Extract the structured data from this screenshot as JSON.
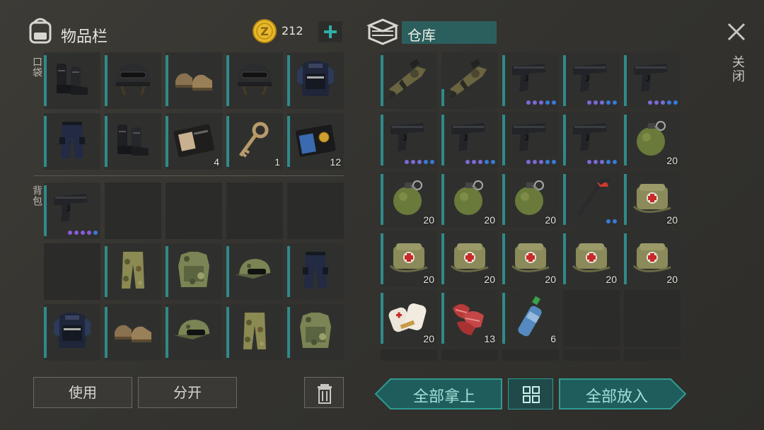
{
  "inventory": {
    "title": "物品栏",
    "coins": "212",
    "pocket_label": "口袋",
    "backpack_label": "背包",
    "pocket": [
      {
        "icon": "boots-icon"
      },
      {
        "icon": "helmet-icon"
      },
      {
        "icon": "shoes-icon"
      },
      {
        "icon": "helmet-icon"
      },
      {
        "icon": "police-vest-icon"
      },
      {
        "icon": "police-pants-icon"
      },
      {
        "icon": "boots-icon"
      },
      {
        "icon": "wallet-icon",
        "count": "4"
      },
      {
        "icon": "key-icon",
        "count": "1"
      },
      {
        "icon": "badge-wallet-icon",
        "count": "12"
      }
    ],
    "backpack": [
      {
        "icon": "pistol-icon",
        "dots": [
          "#8a5ad8",
          "#8a5ad8",
          "#8a5ad8",
          "#8a5ad8",
          "#3a7ad8"
        ]
      },
      {},
      {},
      {},
      {},
      {},
      {
        "icon": "camo-pants-icon"
      },
      {
        "icon": "camo-vest-icon"
      },
      {
        "icon": "camo-cap-icon"
      },
      {
        "icon": "police-pants-icon"
      },
      {
        "icon": "police-vest-icon"
      },
      {
        "icon": "shoes-icon"
      },
      {
        "icon": "camo-cap-icon"
      },
      {
        "icon": "camo-pants-icon"
      },
      {
        "icon": "camo-vest-icon"
      }
    ],
    "use_label": "使用",
    "split_label": "分开"
  },
  "storage": {
    "title": "仓库",
    "close_label": "关闭",
    "take_all_label": "全部拿上",
    "put_all_label": "全部放入",
    "items": [
      {
        "icon": "grenade-launcher-icon"
      },
      {
        "icon": "grenade-launcher-icon",
        "short": true
      },
      {
        "icon": "pistol-icon",
        "dots": [
          "#7a6ad8",
          "#7a6ad8",
          "#7a6ad8",
          "#3a7ad8",
          "#3a7ad8"
        ]
      },
      {
        "icon": "pistol-icon",
        "dots": [
          "#7a6ad8",
          "#7a6ad8",
          "#7a6ad8",
          "#3a7ad8",
          "#3a7ad8"
        ]
      },
      {
        "icon": "pistol-icon",
        "dots": [
          "#7a6ad8",
          "#7a6ad8",
          "#7a6ad8",
          "#3a7ad8",
          "#3a7ad8"
        ]
      },
      {
        "icon": "pistol-icon",
        "dots": [
          "#7a6ad8",
          "#7a6ad8",
          "#7a6ad8",
          "#3a7ad8",
          "#3a7ad8"
        ]
      },
      {
        "icon": "pistol-icon",
        "dots": [
          "#7a6ad8",
          "#7a6ad8",
          "#7a6ad8",
          "#3a7ad8",
          "#3a7ad8"
        ]
      },
      {
        "icon": "pistol-icon",
        "dots": [
          "#7a6ad8",
          "#7a6ad8",
          "#7a6ad8",
          "#3a7ad8",
          "#3a7ad8"
        ]
      },
      {
        "icon": "pistol-icon",
        "dots": [
          "#7a6ad8",
          "#7a6ad8",
          "#7a6ad8",
          "#3a7ad8",
          "#3a7ad8"
        ]
      },
      {
        "icon": "grenade-icon",
        "count": "20"
      },
      {
        "icon": "grenade-icon",
        "count": "20"
      },
      {
        "icon": "grenade-icon",
        "count": "20"
      },
      {
        "icon": "grenade-icon",
        "count": "20"
      },
      {
        "icon": "crowbar-icon",
        "dots": [
          "#3a7ad8",
          "#3a7ad8"
        ]
      },
      {
        "icon": "medkit-bag-icon",
        "count": "20"
      },
      {
        "icon": "medkit-bag-icon",
        "count": "20"
      },
      {
        "icon": "medkit-bag-icon",
        "count": "20"
      },
      {
        "icon": "medkit-bag-icon",
        "count": "20"
      },
      {
        "icon": "medkit-bag-icon",
        "count": "20"
      },
      {
        "icon": "medkit-bag-icon",
        "count": "20"
      },
      {
        "icon": "bandage-icon",
        "count": "20"
      },
      {
        "icon": "raw-meat-icon",
        "count": "13"
      },
      {
        "icon": "water-bottle-icon",
        "count": "6"
      },
      {},
      {}
    ]
  },
  "colors": {
    "accent": "#2f9a92",
    "coin": "#e8b92a",
    "rarity_purple": "#8a5ad8",
    "rarity_blue": "#3a7ad8"
  }
}
